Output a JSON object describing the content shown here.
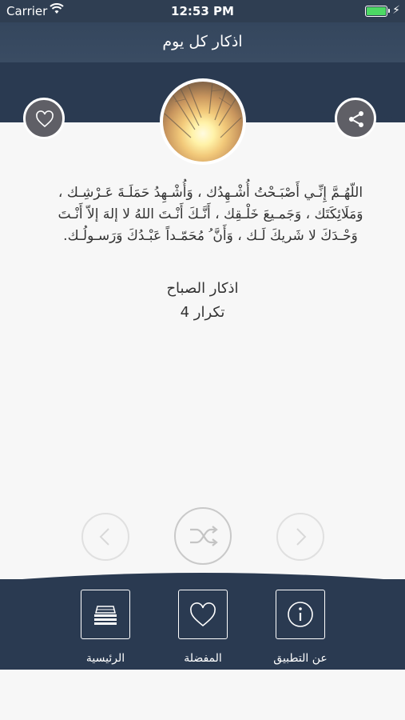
{
  "status_bar": {
    "carrier": "Carrier",
    "time": "12:53 PM"
  },
  "nav": {
    "title": "اذكار كل يوم"
  },
  "header": {
    "favorite_icon": "heart-icon",
    "share_icon": "share-icon",
    "photo": "sunrise-through-branches"
  },
  "content": {
    "zikr": "اللّهُـمَّ إِنِّـي أَصْبَـحْتُ أُشْـهِدُك ، وَأُشْـهِدُ حَمَلَـةَ عَـرْشِـك ، وَمَلَائِكَتَك ، وَجَمـيعَ خَلْـقِك ، أَنَّـكَ أَنْـتَ اللهُ لا إلهَ إلاّ أَنْـتَ وَحْـدَكَ لا شَريكَ لَـك ، وَأَنَّ ُ مُحَمّـداً عَبْـدُكَ وَرَسـولُـك.",
    "category": "اذكار الصباح",
    "repeat": "تكرار 4"
  },
  "controls": {
    "prev_icon": "chevron-left-icon",
    "shuffle_icon": "shuffle-icon",
    "next_icon": "chevron-right-icon"
  },
  "footer": {
    "home_label": "الرئيسية",
    "favorites_label": "المفضلة",
    "about_label": "عن التطبيق"
  },
  "colors": {
    "navy": "#2a3a51",
    "button_gray": "#5f5f66",
    "background": "#f7f7f7"
  }
}
